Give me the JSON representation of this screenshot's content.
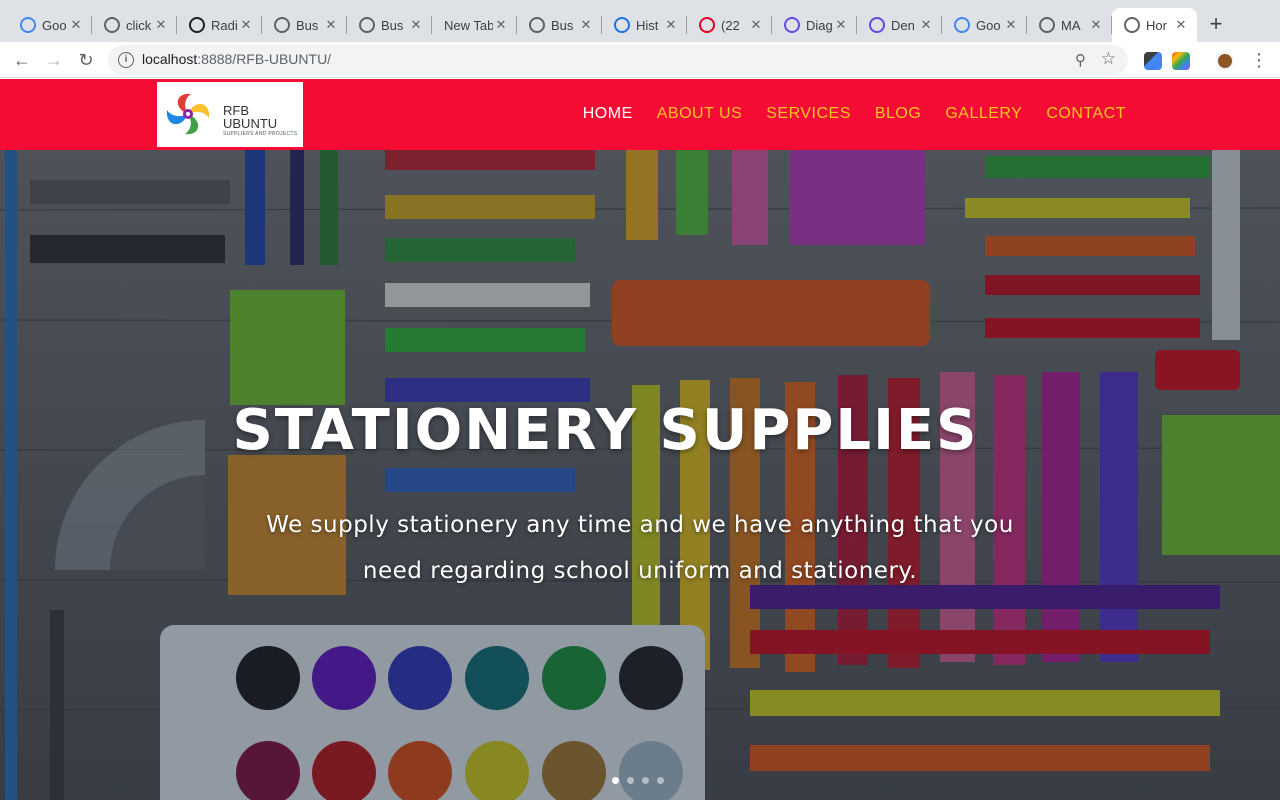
{
  "browser": {
    "tabs": [
      {
        "title": "Goo",
        "favicon": "google-icon",
        "color": "#4285f4"
      },
      {
        "title": "click",
        "favicon": "globe-icon",
        "color": "#5f6368"
      },
      {
        "title": "Radi",
        "favicon": "radix-icon",
        "color": "#202124"
      },
      {
        "title": "Bus",
        "favicon": "globe-icon",
        "color": "#5f6368"
      },
      {
        "title": "Bus",
        "favicon": "globe-icon",
        "color": "#5f6368"
      },
      {
        "title": "New Tab",
        "favicon": "",
        "color": ""
      },
      {
        "title": "Bus",
        "favicon": "globe-icon",
        "color": "#5f6368"
      },
      {
        "title": "Hist",
        "favicon": "history-icon",
        "color": "#1a73e8"
      },
      {
        "title": "(22",
        "favicon": "pinterest-icon",
        "color": "#e60023"
      },
      {
        "title": "Diag",
        "favicon": "diagram-icon",
        "color": "#5c4ee5"
      },
      {
        "title": "Den",
        "favicon": "diagram-icon",
        "color": "#5c4ee5"
      },
      {
        "title": "Goo",
        "favicon": "google-icon",
        "color": "#4285f4"
      },
      {
        "title": "MA",
        "favicon": "github-icon",
        "color": "#5f6368"
      },
      {
        "title": "Hor",
        "favicon": "github-icon",
        "color": "#5f6368"
      }
    ],
    "url_host": "localhost",
    "url_rest": ":8888/RFB-UBUNTU/"
  },
  "site": {
    "logo": {
      "line1": "RFB",
      "line2": "UBUNTU",
      "tagline": "SUPPLIERS AND PROJECTS"
    },
    "nav": [
      {
        "label": "HOME",
        "active": true
      },
      {
        "label": "ABOUT US",
        "active": false
      },
      {
        "label": "SERVICES",
        "active": false
      },
      {
        "label": "BLOG",
        "active": false
      },
      {
        "label": "GALLERY",
        "active": false
      },
      {
        "label": "CONTACT",
        "active": false
      }
    ],
    "brand_color": "#f50c35",
    "nav_color": "#f3c623"
  },
  "hero": {
    "title": "STATIONERY SUPPLIES",
    "line1": "We supply stationery any time and we have anything that you",
    "line2": "need regarding school uniform and stationery.",
    "slides": 4,
    "active_slide": 0
  }
}
